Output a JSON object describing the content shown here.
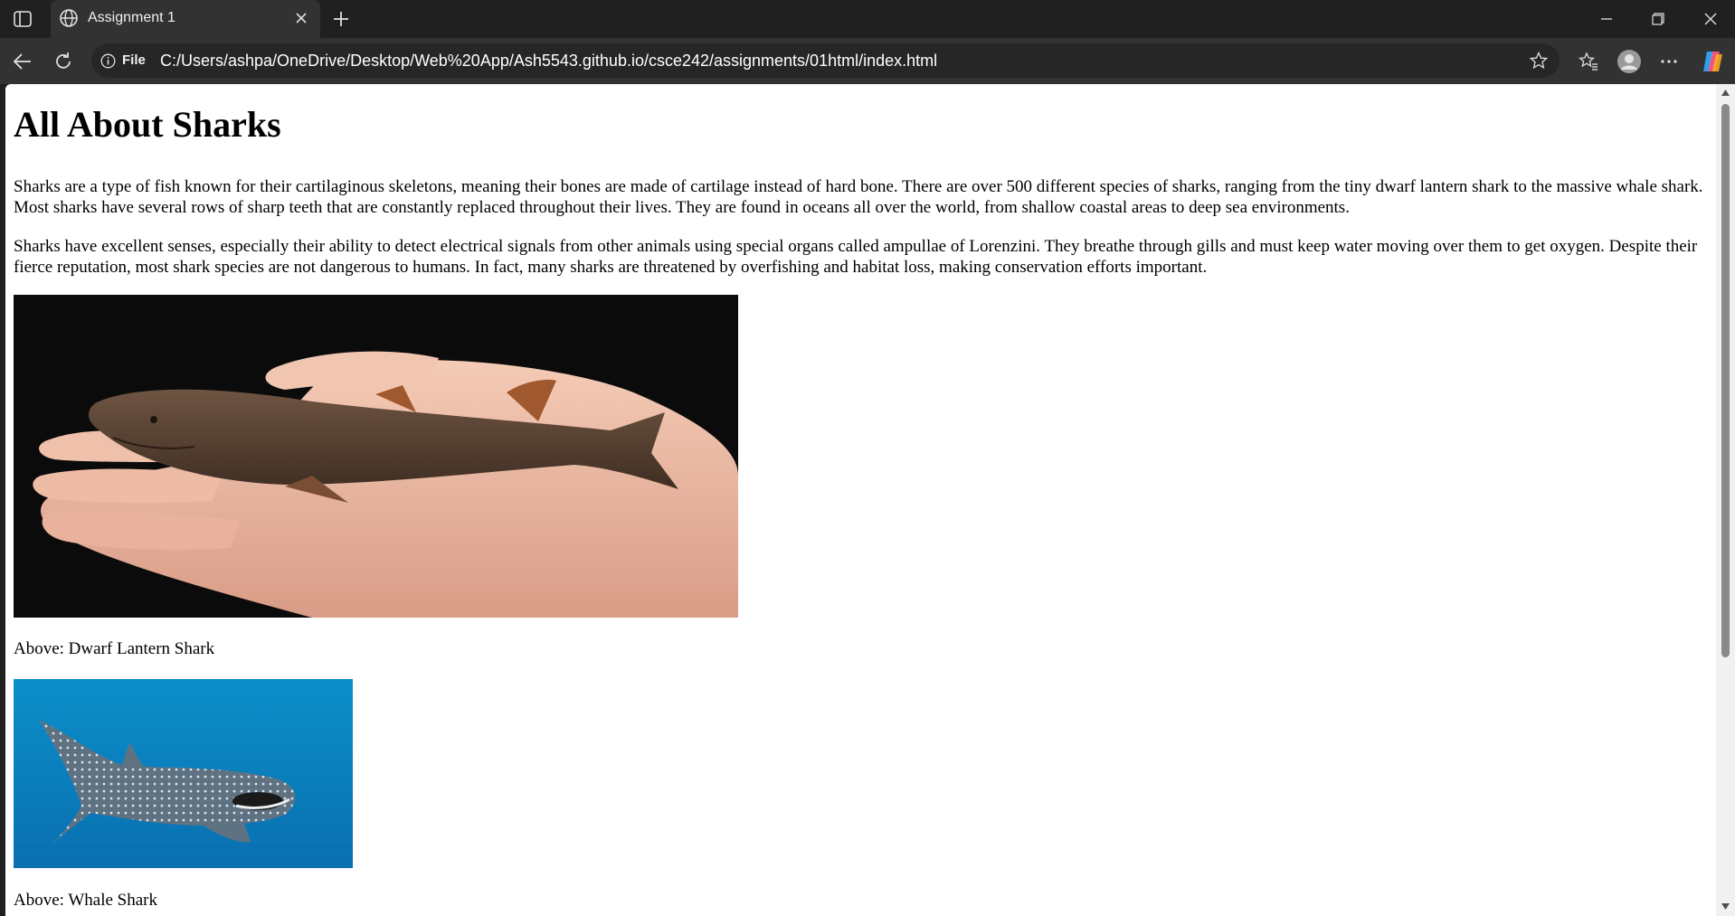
{
  "browser": {
    "tab_title": "Assignment 1",
    "address_label": "File",
    "url": "C:/Users/ashpa/OneDrive/Desktop/Web%20App/Ash5543.github.io/csce242/assignments/01html/index.html"
  },
  "page": {
    "heading": "All About Sharks",
    "paragraph1": "Sharks are a type of fish known for their cartilaginous skeletons, meaning their bones are made of cartilage instead of hard bone. There are over 500 different species of sharks, ranging from the tiny dwarf lantern shark to the massive whale shark. Most sharks have several rows of sharp teeth that are constantly replaced throughout their lives. They are found in oceans all over the world, from shallow coastal areas to deep sea environments.",
    "paragraph2": "Sharks have excellent senses, especially their ability to detect electrical signals from other animals using special organs called ampullae of Lorenzini. They breathe through gills and must keep water moving over them to get oxygen. Despite their fierce reputation, most shark species are not dangerous to humans. In fact, many sharks are threatened by overfishing and habitat loss, making conservation efforts important.",
    "caption1": "Above: Dwarf Lantern Shark",
    "caption2": "Above: Whale Shark"
  },
  "icons": [
    "sidebar-icon",
    "globe-icon",
    "close-icon",
    "new-tab-icon",
    "minimize-icon",
    "restore-icon",
    "window-close-icon",
    "back-icon",
    "refresh-icon",
    "info-icon",
    "favorite-star-icon",
    "favorites-icon",
    "profile-icon",
    "more-icon",
    "copilot-icon"
  ],
  "colors": {
    "titlebar": "#202020",
    "toolbar": "#323232",
    "page_bg": "#ffffff"
  }
}
